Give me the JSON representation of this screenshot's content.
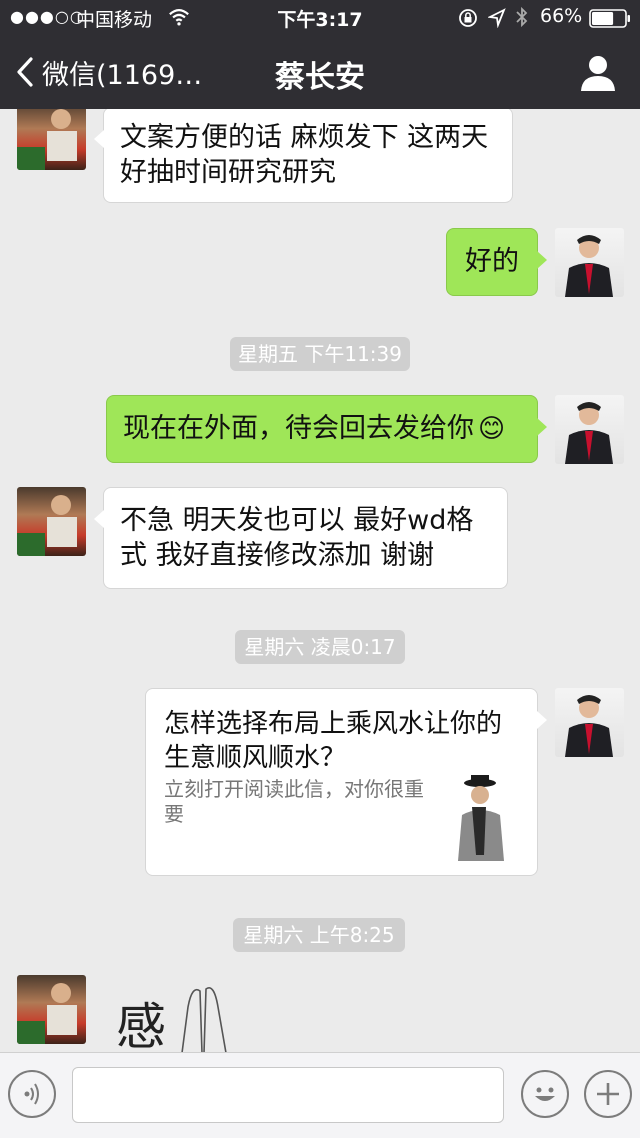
{
  "status_bar": {
    "signal": "●●●○○",
    "carrier": "中国移动",
    "time": "下午3:17",
    "battery_percent": "66%",
    "battery_level": 0.66
  },
  "nav": {
    "back_label": "微信(1169…",
    "title": "蔡长安"
  },
  "messages": [
    {
      "lines": [
        "文案方便的话 麻烦发下 这两天",
        "好抽时间研究研究"
      ]
    },
    {
      "lines": [
        "好的"
      ]
    },
    {
      "time": "星期五 下午11:39"
    },
    {
      "lines": [
        "现在在外面，待会回去发给你"
      ],
      "emoji": "😊"
    },
    {
      "lines": [
        "不急  明天发也可以  最好wd格",
        "式 我好直接修改添加  谢谢"
      ]
    },
    {
      "time": "星期六 凌晨0:17"
    },
    {
      "card": {
        "title": "怎样选择布局上乘风水让你的生意顺风顺水？",
        "description": "立刻打开阅读此信，对你很重要"
      }
    },
    {
      "time": "星期六 上午8:25"
    },
    {
      "sticker": "感"
    }
  ],
  "input": {
    "placeholder": ""
  },
  "icons": {
    "wifi": "wifi-icon",
    "lock": "rotation-lock-icon",
    "location": "location-arrow-icon",
    "bluetooth": "bluetooth-icon",
    "battery": "battery-icon",
    "back": "chevron-left-icon",
    "contact": "person-icon",
    "voice": "voice-icon",
    "emoji": "emoji-icon",
    "plus": "plus-icon"
  },
  "colors": {
    "topbar": "#2f2e33",
    "chat_bg": "#ebebeb",
    "sent_bubble": "#9fe658",
    "received_bubble": "#ffffff",
    "time_chip": "#cfcfcf"
  }
}
